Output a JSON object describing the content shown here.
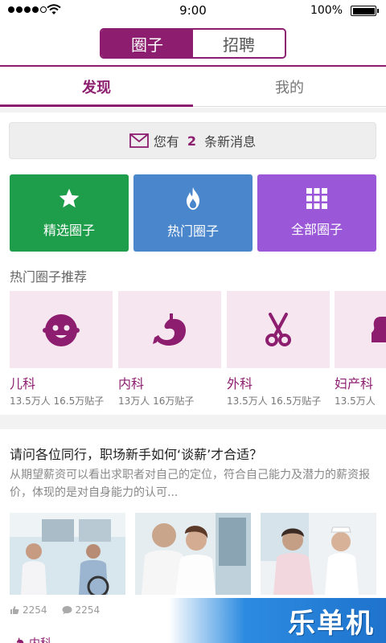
{
  "status_bar": {
    "time": "9:00",
    "battery_percent": "100%",
    "battery_level": 1.0,
    "signal_filled": 4,
    "signal_total": 5
  },
  "segmented": {
    "active": "圈子",
    "inactive": "招聘"
  },
  "tabs": [
    {
      "label": "发现",
      "active": true
    },
    {
      "label": "我的",
      "active": false
    }
  ],
  "message_bar": {
    "prefix": "您有",
    "count": "2",
    "suffix": "条新消息",
    "icon": "envelope-icon"
  },
  "categories": [
    {
      "label": "精选圈子",
      "icon": "star-icon",
      "color": "#1e9e4a"
    },
    {
      "label": "热门圈子",
      "icon": "flame-icon",
      "color": "#4a86cc"
    },
    {
      "label": "全部圈子",
      "icon": "grid-icon",
      "color": "#9a58d8"
    }
  ],
  "hot_circles": {
    "title": "热门圈子推荐",
    "items": [
      {
        "name": "儿科",
        "stats": "13.5万人 16.5万贴子",
        "icon": "baby-face-icon"
      },
      {
        "name": "内科",
        "stats": "13万人 16万贴子",
        "icon": "stomach-icon"
      },
      {
        "name": "外科",
        "stats": "13.5万人 16.5万贴子",
        "icon": "scissors-icon"
      },
      {
        "name": "妇产科",
        "stats": "13.5万人",
        "icon": "woman-icon"
      }
    ]
  },
  "article": {
    "title": "请问各位同行，职场新手如何‘谈薪’才合适？",
    "description": "从期望薪资可以看出求职者对自己的定位，符合自己能力及潜力的薪资报价，体现的是对自身能力的认可...",
    "likes": "2254",
    "comments": "2254"
  },
  "next_item": {
    "label": "内科"
  },
  "watermark": {
    "text": "乐单机"
  },
  "colors": {
    "accent": "#8d1e6f"
  }
}
